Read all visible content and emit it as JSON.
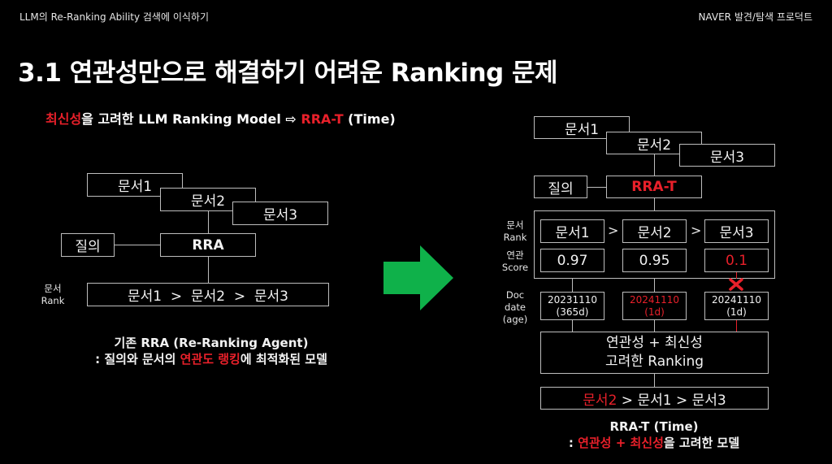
{
  "header": {
    "left": "LLM의 Re-Ranking Ability 검색에 이식하기",
    "right": "NAVER 발견/탐색 프로덕트"
  },
  "title": "3.1 연관성만으로 해결하기 어려운 Ranking 문제",
  "subtitle": {
    "part1_red": "최신성",
    "part2": "을 고려한 LLM Ranking Model ⇨ ",
    "part3_red": "RRA-T",
    "part4": " (Time)"
  },
  "left_diagram": {
    "docs": [
      "문서1",
      "문서2",
      "문서3"
    ],
    "query": "질의",
    "model": "RRA",
    "rank_label_line1": "문서",
    "rank_label_line2": "Rank",
    "rank_result": "문서1  >  문서2  >  문서3",
    "caption_line1": "기존 RRA (Re-Ranking Agent)",
    "caption_line2_pre": ": 질의와 문서의 ",
    "caption_line2_red": "연관도 랭킹",
    "caption_line2_post": "에 최적화된 모델"
  },
  "arrow": {
    "icon": "right-arrow-icon",
    "color": "#0fb14a"
  },
  "right_diagram": {
    "docs": [
      "문서1",
      "문서2",
      "문서3"
    ],
    "query": "질의",
    "model": "RRA-T",
    "rank_label_line1": "문서",
    "rank_label_line2": "Rank",
    "score_label_line1": "연관",
    "score_label_line2": "Score",
    "date_label_line1": "Doc",
    "date_label_line2": "date",
    "date_label_line3": "(age)",
    "gt": ">",
    "ranked_docs": [
      "문서1",
      "문서2",
      "문서3"
    ],
    "scores": [
      "0.97",
      "0.95",
      "0.1"
    ],
    "dates": [
      {
        "date": "20231110",
        "age": "(365d)",
        "highlight": false
      },
      {
        "date": "20241110",
        "age": "(1d)",
        "highlight": true
      },
      {
        "date": "20241110",
        "age": "(1d)",
        "highlight": false
      }
    ],
    "combine_line1": "연관성 + 최신성",
    "combine_line2": "고려한 Ranking",
    "final_red": "문서2",
    "final_rest": " > 문서1 > 문서3",
    "caption_line1": "RRA-T (Time)",
    "caption_line2_pre": ": ",
    "caption_line2_red": "연관성 + 최신성",
    "caption_line2_post": "을 고려한 모델"
  },
  "colors": {
    "accent_red": "#e8202a",
    "arrow_green": "#0fb14a",
    "line_gray": "#bdbdbd"
  }
}
